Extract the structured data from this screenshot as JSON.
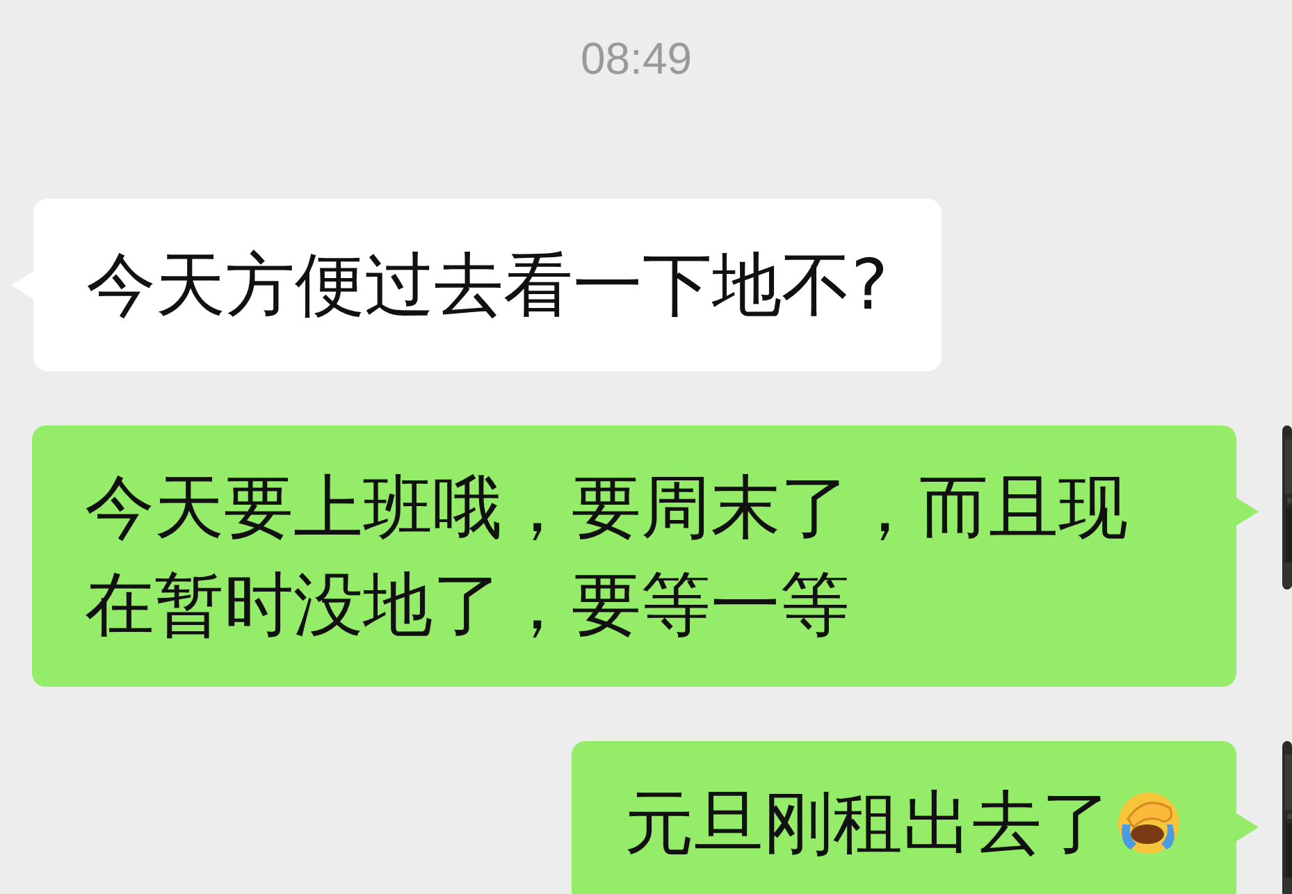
{
  "time": "08:49",
  "messages": [
    {
      "kind": "incoming",
      "text": "今天方便过去看一下地不?",
      "emoji": false
    },
    {
      "kind": "outgoing",
      "text": "今天要上班哦，要周末了，而且现在暂时没地了，要等一等",
      "emoji": false
    },
    {
      "kind": "outgoing",
      "text": "元旦刚租出去了",
      "emoji": true
    }
  ]
}
